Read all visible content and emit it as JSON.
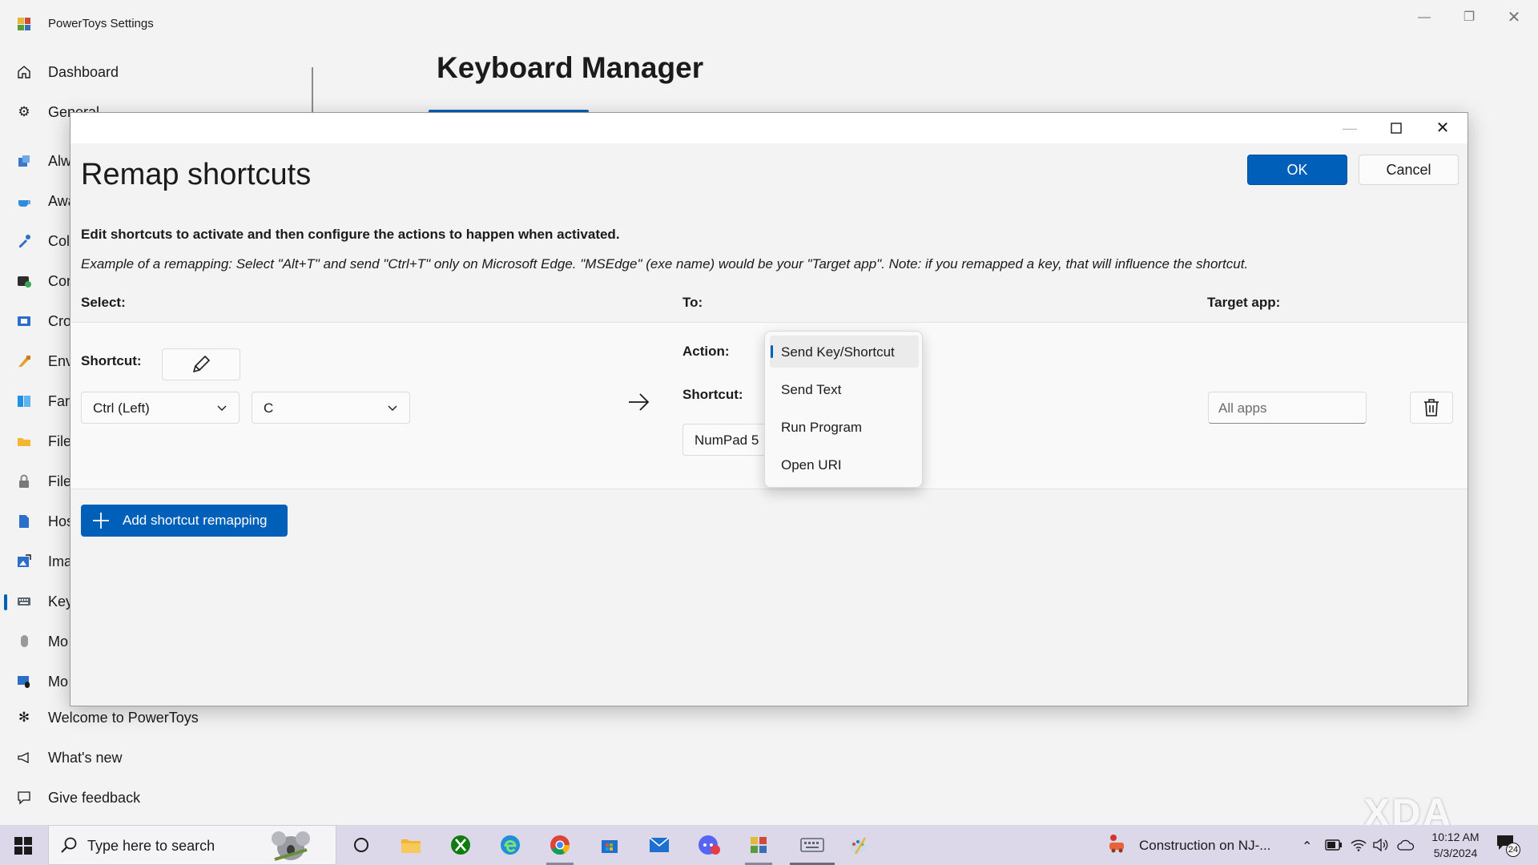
{
  "window": {
    "title": "PowerToys Settings",
    "page_title": "Keyboard Manager"
  },
  "sidebar": {
    "items": [
      {
        "label": "Dashboard",
        "icon": "home-icon"
      },
      {
        "label": "General",
        "icon": "gear-icon"
      },
      {
        "label": "Alw",
        "icon": "always-on-top-icon"
      },
      {
        "label": "Awa",
        "icon": "awake-icon"
      },
      {
        "label": "Col",
        "icon": "color-picker-icon"
      },
      {
        "label": "Con",
        "icon": "command-not-found-icon"
      },
      {
        "label": "Cro",
        "icon": "crop-and-lock-icon"
      },
      {
        "label": "Env",
        "icon": "environment-variables-icon"
      },
      {
        "label": "Fan",
        "icon": "fancyzones-icon"
      },
      {
        "label": "File",
        "icon": "file-explorer-addons-icon"
      },
      {
        "label": "File",
        "icon": "file-locksmith-icon"
      },
      {
        "label": "Hos",
        "icon": "hosts-file-editor-icon"
      },
      {
        "label": "Ima",
        "icon": "image-resizer-icon"
      },
      {
        "label": "Key",
        "icon": "keyboard-icon"
      },
      {
        "label": "Mo",
        "icon": "mouse-utilities-icon"
      },
      {
        "label": "Mo",
        "icon": "mouse-without-borders-icon"
      },
      {
        "label": "Welcome to PowerToys",
        "icon": "welcome-icon"
      },
      {
        "label": "What's new",
        "icon": "megaphone-icon"
      },
      {
        "label": "Give feedback",
        "icon": "feedback-icon"
      }
    ]
  },
  "dialog": {
    "title": "Remap shortcuts",
    "ok_label": "OK",
    "cancel_label": "Cancel",
    "description": "Edit shortcuts to activate and then configure the actions to happen when activated.",
    "example": "Example of a remapping: Select \"Alt+T\" and send \"Ctrl+T\" only on Microsoft Edge. \"MSEdge\" (exe name) would be your \"Target app\". Note: if you remapped a key, that will influence the shortcut.",
    "columns": {
      "select": "Select:",
      "to": "To:",
      "target_app": "Target app:"
    },
    "row": {
      "shortcut_label": "Shortcut:",
      "modifier_value": "Ctrl (Left)",
      "key_value": "C",
      "action_label": "Action:",
      "to_shortcut_label": "Shortcut:",
      "to_key_value": "NumPad 5",
      "target_app_placeholder": "All apps"
    },
    "action_options": [
      "Send Key/Shortcut",
      "Send Text",
      "Run Program",
      "Open URI"
    ],
    "action_selected": "Send Key/Shortcut",
    "add_label": "Add shortcut remapping"
  },
  "taskbar": {
    "search_placeholder": "Type here to search",
    "weather_text": "Construction on NJ-...",
    "time": "10:12 AM",
    "date": "5/3/2024",
    "notification_count": "24"
  },
  "watermark": "XDA",
  "colors": {
    "accent": "#005fb8"
  }
}
